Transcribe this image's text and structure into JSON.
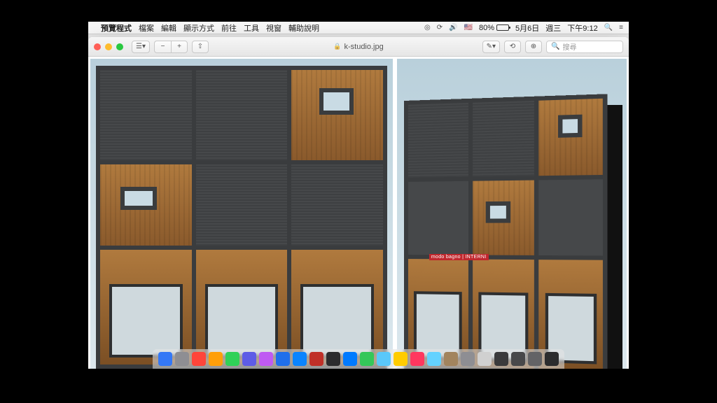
{
  "menubar": {
    "app_name": "預覽程式",
    "items": [
      "檔案",
      "編輯",
      "顯示方式",
      "前往",
      "工具",
      "視窗",
      "輔助說明"
    ],
    "battery_pct": "80%",
    "date": "5月6日",
    "weekday": "週三",
    "time": "下午9:12"
  },
  "window": {
    "filename": "k-studio.jpg",
    "search_placeholder": "搜尋",
    "sign_text": "modo bagno | INTERNI"
  },
  "dock_colors": [
    "#3478f6",
    "#8e8e93",
    "#ff453a",
    "#ff9f0a",
    "#30d158",
    "#5e5ce6",
    "#bf5af2",
    "#1f6feb",
    "#0a84ff",
    "#c03028",
    "#2c2c2e",
    "#007aff",
    "#34c759",
    "#5ac8fa",
    "#ffcc00",
    "#ff375f",
    "#64d2ff",
    "#a2845e",
    "#8e8e93",
    "#d0d0d0",
    "#3a3a3c",
    "#48484a",
    "#636366",
    "#2c2c2e"
  ]
}
